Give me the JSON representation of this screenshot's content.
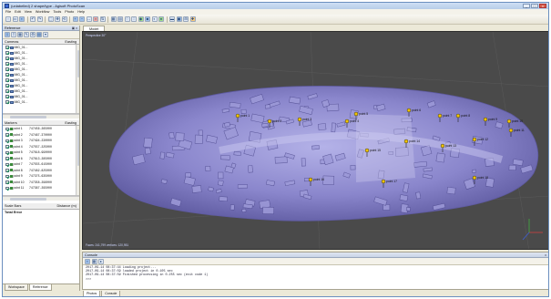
{
  "window": {
    "title": "(unlabelled) 2 shape/type - Agisoft PhotoScan",
    "minimize": "_",
    "maximize": "□",
    "close": "x"
  },
  "menu": [
    "File",
    "Edit",
    "View",
    "Workflow",
    "Tools",
    "Photo",
    "Help"
  ],
  "toolbar_icons": [
    "new-icon",
    "open-icon",
    "save-icon",
    "undo-icon",
    "redo-icon",
    "select-icon",
    "navigation-icon",
    "rotate-icon",
    "zoom-in-icon",
    "zoom-out-icon",
    "move-icon",
    "reset-view-icon",
    "camera-icon",
    "model-icon",
    "texture-icon",
    "point-cloud-icon",
    "dense-cloud-icon",
    "wireframe-icon",
    "solid-icon",
    "shaded-icon",
    "textured-icon",
    "marker-icon",
    "ruler-icon"
  ],
  "reference_panel": {
    "title": "Reference",
    "cameras_header": "Cameras",
    "cameras_col": "Easting",
    "cameras": [
      "IMG_01...",
      "IMG_01...",
      "IMG_01...",
      "IMG_01...",
      "IMG_01...",
      "IMG_01...",
      "IMG_01...",
      "IMG_01...",
      "IMG_01...",
      "IMG_01...",
      "IMG_01..."
    ],
    "markers_header": "Markers",
    "markers_col": "Easting",
    "markers": [
      {
        "name": "point 1",
        "value": "747456.265000"
      },
      {
        "name": "point 2",
        "value": "747467.370000"
      },
      {
        "name": "point 3",
        "value": "747494.230000"
      },
      {
        "name": "point 4",
        "value": "747557.225000"
      },
      {
        "name": "point 5",
        "value": "747618.990000"
      },
      {
        "name": "point 6",
        "value": "747613.285000"
      },
      {
        "name": "point 7",
        "value": "747555.615000"
      },
      {
        "name": "point 8",
        "value": "747482.825000"
      },
      {
        "name": "point 9",
        "value": "747375.635000"
      },
      {
        "name": "point 10",
        "value": "747358.296000"
      },
      {
        "name": "point 11",
        "value": "747367.295000"
      }
    ],
    "scalebars_header": "Scale Bars",
    "scalebars_col": "Distance (m)",
    "total_error": "Total Error"
  },
  "left_tabs": [
    "Workspace",
    "Reference"
  ],
  "model_tab": "Model",
  "viewport": {
    "perspective_label": "Perspective 30°",
    "info_label": "Faces: 241,799 vertices: 120,951",
    "markers": [
      "point 1",
      "point 2",
      "point 3",
      "point 4",
      "point 5",
      "point 6",
      "point 7",
      "point 8",
      "point 9",
      "point 10",
      "point 11",
      "point 12",
      "point 13",
      "point 14",
      "point 15",
      "point 16",
      "point 17",
      "point 18"
    ]
  },
  "console": {
    "title": "Console",
    "lines": [
      "2017-09-14 08:37:44 Loading project...",
      "2017-09-14 08:37:59 loaded project in 0.105 sec",
      "2017-09-14 08:37:59 Finished processing in 0.255 sec (exit code 1)",
      ">>>"
    ]
  },
  "right_tabs": [
    "Photos",
    "Console"
  ],
  "colors": {
    "mesh": "#8a86cc",
    "mesh_dark": "#5e5aa0",
    "mesh_light": "#b4b2e8",
    "viewport_bg": "#4a4a4a",
    "marker": "#f2c400"
  }
}
